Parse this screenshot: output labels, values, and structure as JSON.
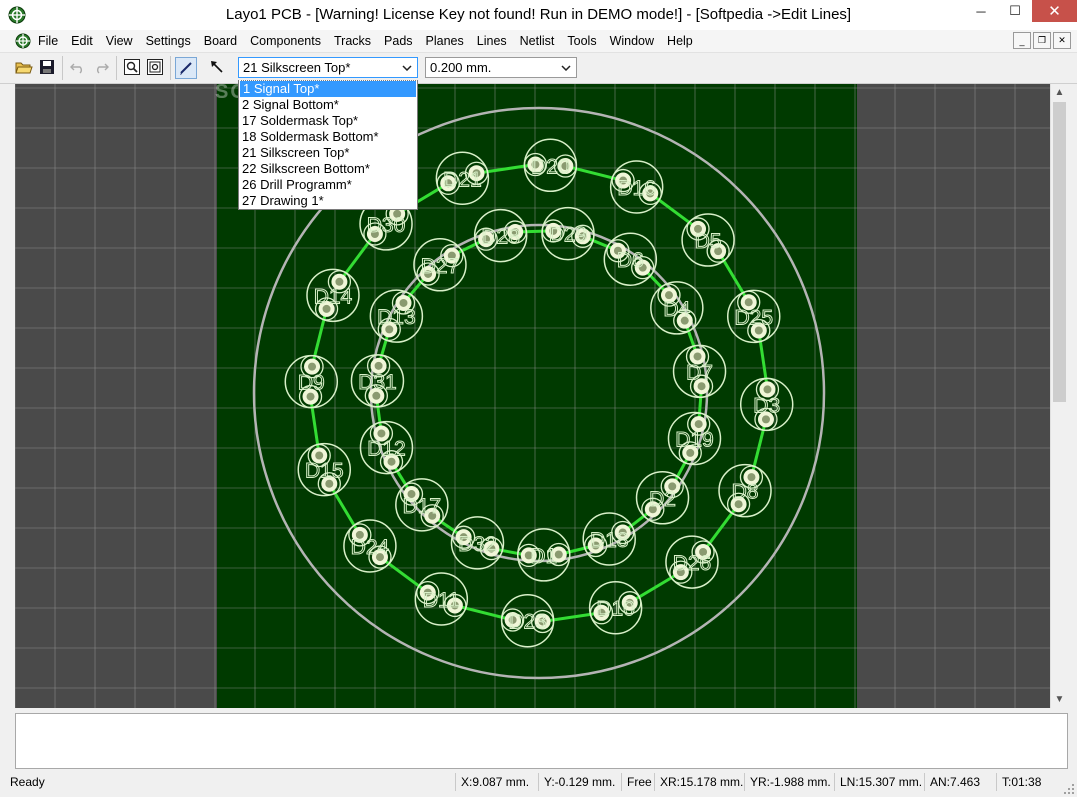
{
  "window": {
    "title": "Layo1 PCB - [Warning! License Key not found! Run in DEMO mode!] - [Softpedia ->Edit Lines]",
    "minimize_glyph": "─",
    "maximize_glyph": "☐",
    "close_glyph": "✕"
  },
  "menu": {
    "items": [
      "File",
      "Edit",
      "View",
      "Settings",
      "Board",
      "Components",
      "Tracks",
      "Pads",
      "Planes",
      "Lines",
      "Netlist",
      "Tools",
      "Window",
      "Help"
    ],
    "mdi_buttons": [
      "_",
      "❐",
      "✕"
    ]
  },
  "toolbar": {
    "layer_select": "21 Silkscreen Top*",
    "width_select": "0.200 mm.",
    "icons": [
      "open-folder-icon",
      "save-icon",
      "undo-icon",
      "redo-icon",
      "zoom-icon",
      "zoom-fit-icon",
      "draw-line-icon",
      "select-arrow-icon"
    ]
  },
  "layer_dropdown": {
    "options": [
      "1 Signal Top*",
      " 2 Signal Bottom*",
      "17 Soldermask Top*",
      "18 Soldermask Bottom*",
      "21 Silkscreen Top*",
      "22 Silkscreen Bottom*",
      "26 Drill Programm*",
      "27 Drawing 1*"
    ],
    "highlighted": 0
  },
  "pcb": {
    "watermark": "SOFTPEDIA",
    "colors": {
      "board": "#003a00",
      "background": "#4a4a4a",
      "grid": "#9a9a9a",
      "track": "#33dd33",
      "silk": "#d8f0c8",
      "circle": "#b4b4b4",
      "pad": "#8a9a70"
    },
    "components": [
      {
        "label": "D20"
      },
      {
        "label": "D29"
      },
      {
        "label": "D16"
      },
      {
        "label": "D6"
      },
      {
        "label": "D5"
      },
      {
        "label": "D4"
      },
      {
        "label": "D25"
      },
      {
        "label": "D7"
      },
      {
        "label": "D3"
      },
      {
        "label": "D19"
      },
      {
        "label": "D8"
      },
      {
        "label": "D2"
      },
      {
        "label": "D26"
      },
      {
        "label": "D18"
      },
      {
        "label": "D10"
      },
      {
        "label": "D1"
      },
      {
        "label": "D23"
      },
      {
        "label": "D32"
      },
      {
        "label": "D11"
      },
      {
        "label": "D17"
      },
      {
        "label": "D24"
      },
      {
        "label": "D12"
      },
      {
        "label": "D15"
      },
      {
        "label": "D31"
      },
      {
        "label": "D9"
      },
      {
        "label": "D13"
      },
      {
        "label": "D14"
      },
      {
        "label": "D27"
      },
      {
        "label": "D30"
      },
      {
        "label": "D28"
      },
      {
        "label": "D21"
      }
    ]
  },
  "status": {
    "state": "Ready",
    "x": "X:9.087 mm.",
    "y": "Y:-0.129 mm.",
    "mode": "Free",
    "xr": "XR:15.178 mm.",
    "yr": "YR:-1.988 mm.",
    "ln": "LN:15.307 mm.",
    "an": "AN:7.463",
    "time": "T:01:38"
  }
}
